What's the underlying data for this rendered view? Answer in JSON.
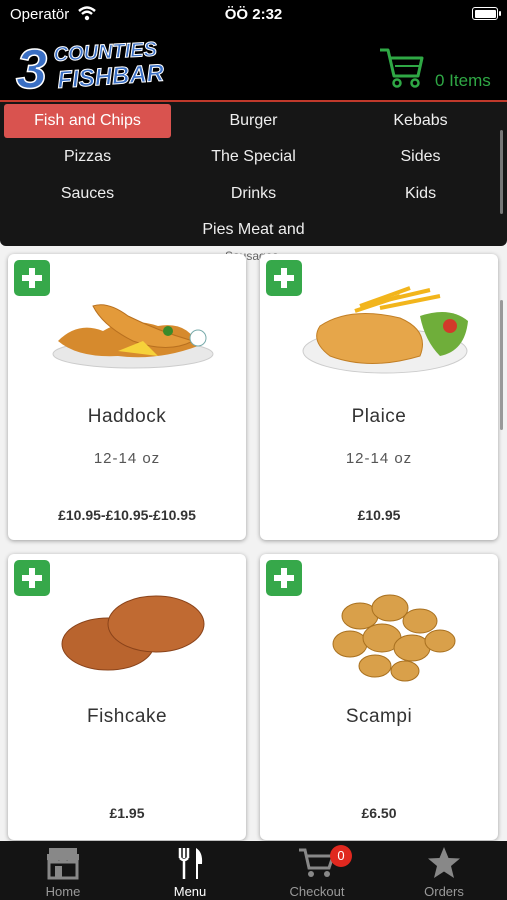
{
  "status_bar": {
    "carrier": "Operatör",
    "time": "ÖÖ 2:32"
  },
  "header": {
    "logo_line1": "3",
    "logo_line2": "COUNTIES",
    "logo_line3": "FISHBAR",
    "cart_label": "0 Items"
  },
  "categories": {
    "row1": [
      "Fish and Chips",
      "Burger",
      "Kebabs"
    ],
    "row2": [
      "Pizzas",
      "The Special",
      "Sides"
    ],
    "row3": [
      "Sauces",
      "Drinks",
      "Kids"
    ],
    "row4": [
      "Pies Meat and"
    ],
    "faded": "Sausages",
    "active": "Fish and Chips"
  },
  "products": [
    {
      "name": "Haddock",
      "size": "12-14 oz",
      "price": "£10.95-£10.95-£10.95"
    },
    {
      "name": "Plaice",
      "size": "12-14 oz",
      "price": "£10.95"
    },
    {
      "name": "Fishcake",
      "size": "",
      "price": "£1.95"
    },
    {
      "name": "Scampi",
      "size": "",
      "price": "£6.50"
    }
  ],
  "tabs": [
    {
      "label": "Home",
      "icon": "store-icon"
    },
    {
      "label": "Menu",
      "icon": "fork-knife-icon"
    },
    {
      "label": "Checkout",
      "icon": "cart-icon"
    },
    {
      "label": "Orders",
      "icon": "star-icon"
    }
  ],
  "checkout_badge": "0",
  "colors": {
    "accent": "#d9534f",
    "green": "#36a84a",
    "header_bg": "#000000",
    "logo_blue": "#3a6fc4"
  }
}
